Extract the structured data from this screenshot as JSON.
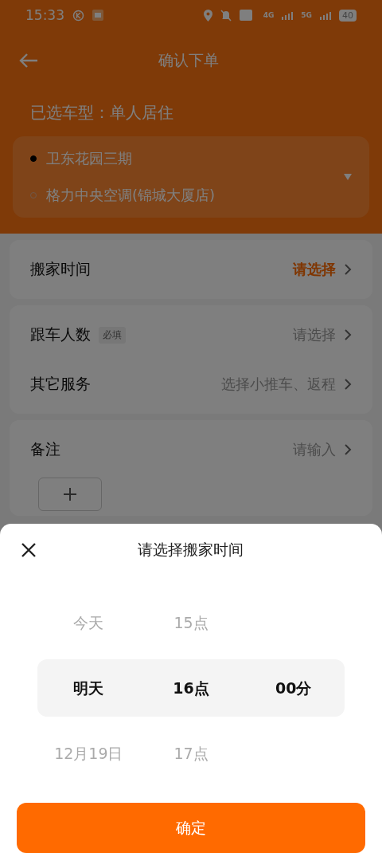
{
  "status_bar": {
    "time": "15:33",
    "network_labels": [
      "4G",
      "5G"
    ],
    "battery": "40"
  },
  "header": {
    "title": "确认下单"
  },
  "vehicle": {
    "label": "已选车型：单人居住"
  },
  "route": {
    "stops": [
      {
        "kind": "origin",
        "name": "卫东花园三期"
      },
      {
        "kind": "destination",
        "name": "格力中央空调(锦城大厦店)"
      }
    ]
  },
  "form_cards": [
    {
      "rows": [
        {
          "label": "搬家时间",
          "value": "请选择",
          "highlighted": true
        }
      ]
    },
    {
      "rows": [
        {
          "label": "跟车人数",
          "tag": "必填",
          "value": "请选择",
          "highlighted": false
        },
        {
          "label": "其它服务",
          "value": "选择小推车、返程",
          "highlighted": false
        }
      ]
    },
    {
      "rows": [
        {
          "label": "备注",
          "value": "请输入",
          "highlighted": false
        }
      ],
      "add_button": true
    }
  ],
  "sheet": {
    "title": "请选择搬家时间",
    "columns": [
      {
        "items": [
          {
            "label": "今天",
            "selected": false
          },
          {
            "label": "明天",
            "selected": true
          },
          {
            "label": "12月19日",
            "selected": false
          }
        ]
      },
      {
        "items": [
          {
            "label": "15点",
            "selected": false
          },
          {
            "label": "16点",
            "selected": true
          },
          {
            "label": "17点",
            "selected": false
          }
        ]
      },
      {
        "items": [
          {
            "label": "00分",
            "selected": true
          }
        ]
      }
    ],
    "confirm_button": "确定"
  }
}
